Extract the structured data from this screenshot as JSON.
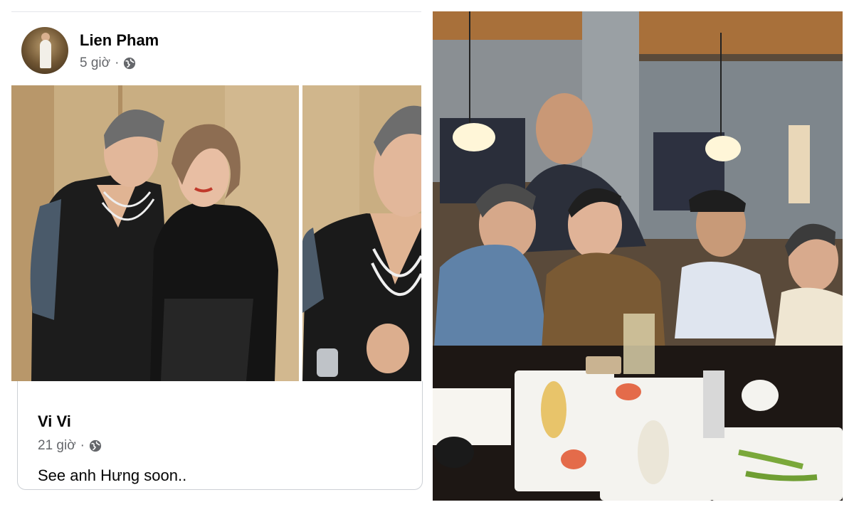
{
  "post": {
    "author": "Lien Pham",
    "time": "5 giờ",
    "separator": "·",
    "privacy_icon": "globe-icon"
  },
  "reply": {
    "author": "Vi Vi",
    "time": "21 giờ",
    "separator": "·",
    "privacy_icon": "globe-icon",
    "text": "See anh Hưng soon.."
  },
  "colors": {
    "name": "#050505",
    "meta": "#65676b",
    "border": "#ccd0d5"
  }
}
